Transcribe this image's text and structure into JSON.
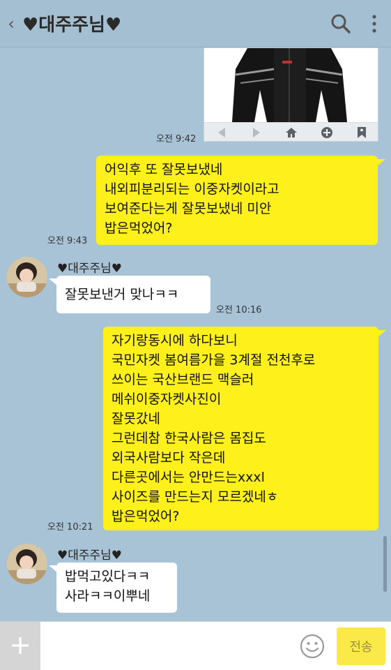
{
  "header": {
    "back_glyph": "‹",
    "title": "♥대주주님♥"
  },
  "messages": [
    {
      "time": "오전 9:42"
    },
    {
      "text": "어익후 또 잘못보냈네\n내외피분리되는 이중자켓이라고\n보여준다는게 잘못보냈네 미안\n밥은먹었어?",
      "time": "오전 9:43"
    },
    {
      "sender": "♥대주주님♥",
      "text": "잘못보낸거 맞나ㅋㅋ",
      "time": "오전 10:16"
    },
    {
      "text": "자기랑동시에 하다보니\n국민자켓 봄여름가을 3계절 전천후로\n쓰이는 국산브랜드 맥슬러\n메쉬이중자켓사진이\n잘못갔네\n그런데참 한국사람은 몸집도\n외국사람보다 작은데\n다른곳에서는 안만드는xxxl\n사이즈를 만드는지 모르겠네ㅎ\n밥은먹었어?",
      "time": "오전 10:21"
    },
    {
      "sender": "♥대주주님♥",
      "text": "밥먹고있다ㅋㅋ\n사라ㅋㅋ이뿌네"
    }
  ],
  "input": {
    "plus_glyph": "+",
    "placeholder": "",
    "send_label": "전송"
  },
  "colors": {
    "chat_bg": "#a9c3d6",
    "my_bubble": "#fef01b",
    "their_bubble": "#ffffff",
    "send_button": "#fbe94a"
  }
}
